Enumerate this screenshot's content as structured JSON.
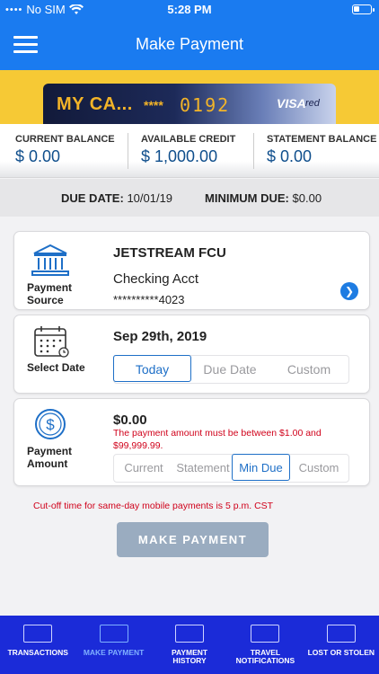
{
  "status_bar": {
    "carrier": "No SIM",
    "time": "5:28 PM"
  },
  "header": {
    "title": "Make Payment"
  },
  "card": {
    "name": "MY CA...",
    "mask": "****",
    "last4": "0192",
    "brand": "VISA",
    "brand_sub": "red"
  },
  "balances": [
    {
      "label": "CURRENT BALANCE",
      "value": "$ 0.00"
    },
    {
      "label": "AVAILABLE CREDIT",
      "value": "$ 1,000.00"
    },
    {
      "label": "STATEMENT BALANCE",
      "value": "$ 0.00"
    }
  ],
  "due": {
    "due_label": "DUE DATE:",
    "due_value": "10/01/19",
    "min_label": "MINIMUM DUE:",
    "min_value": "$0.00"
  },
  "payment_source": {
    "caption_line1": "Payment",
    "caption_line2": "Source",
    "bank": "JETSTREAM FCU",
    "account_type": "Checking Acct",
    "account_number": "**********4023"
  },
  "select_date": {
    "caption": "Select Date",
    "date": "Sep 29th, 2019",
    "options": [
      "Today",
      "Due Date",
      "Custom"
    ],
    "selected": "Today"
  },
  "payment_amount": {
    "caption_line1": "Payment",
    "caption_line2": "Amount",
    "amount": "$0.00",
    "error": "The payment amount must be between $1.00 and $99,999.99.",
    "options": [
      "Current",
      "Statement",
      "Min Due",
      "Custom"
    ],
    "selected": "Min Due"
  },
  "cutoff_note": "Cut-off time for same-day mobile payments is 5 p.m. CST",
  "make_payment_button": "MAKE PAYMENT",
  "tabs": [
    {
      "label_line1": "TRANSACTIONS",
      "label_line2": "",
      "active": false
    },
    {
      "label_line1": "MAKE PAYMENT",
      "label_line2": "",
      "active": true
    },
    {
      "label_line1": "PAYMENT",
      "label_line2": "HISTORY",
      "active": false
    },
    {
      "label_line1": "TRAVEL",
      "label_line2": "NOTIFICATIONS",
      "active": false
    },
    {
      "label_line1": "LOST OR STOLEN",
      "label_line2": "",
      "active": false
    }
  ],
  "colors": {
    "header": "#1a7bf0",
    "banner": "#f6c935",
    "tabbar": "#1b2bd8",
    "error": "#d0021b",
    "accent": "#1e6fc7"
  }
}
